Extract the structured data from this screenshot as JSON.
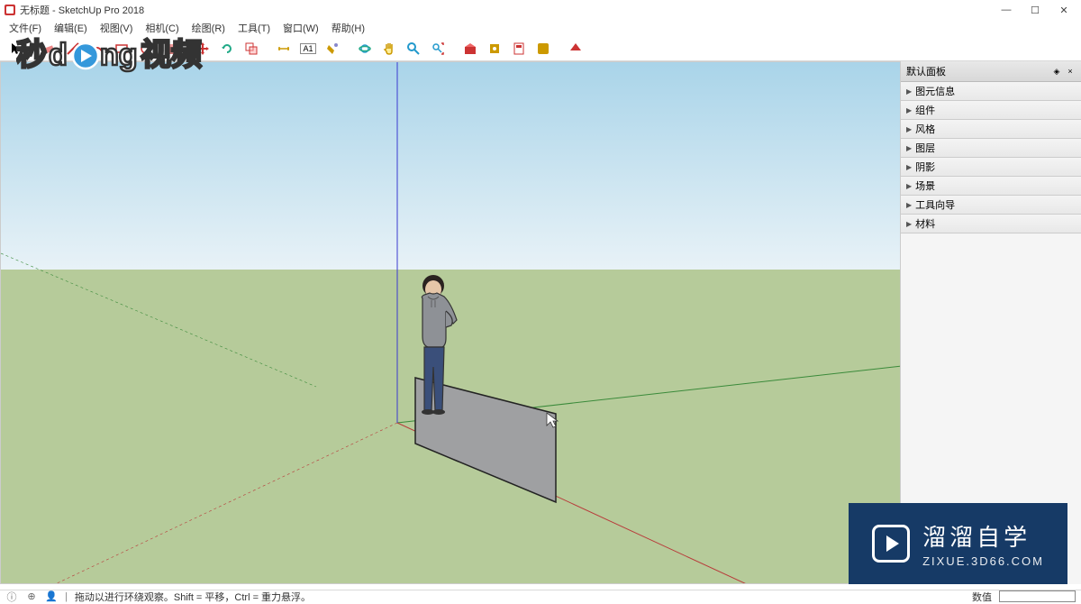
{
  "window": {
    "title": "无标题 - SketchUp Pro 2018",
    "minimize_glyph": "—",
    "maximize_glyph": "☐",
    "close_glyph": "✕"
  },
  "menu": {
    "file": "文件(F)",
    "edit": "编辑(E)",
    "view": "视图(V)",
    "camera": "相机(C)",
    "draw": "绘图(R)",
    "tools": "工具(T)",
    "window": "窗口(W)",
    "help": "帮助(H)"
  },
  "toolbar": {
    "select": "▶",
    "eraser": "◧",
    "line": "◢",
    "arc": "◡",
    "rect": "▭",
    "circle": "◯",
    "pushpull": "⬒",
    "move": "✥",
    "rotate": "⟳",
    "scale": "▣",
    "measure": "📏",
    "text": "A1",
    "paint": "🪣",
    "orbit": "🌐",
    "pan": "✋",
    "zoom": "🔍",
    "zoom_extents": "🔎",
    "warehouse": "📦",
    "share": "📤",
    "layout": "📄",
    "advanced": "⚙"
  },
  "panel": {
    "title": "默认面板",
    "pin_glyph": "◈",
    "close_glyph": "×",
    "items": [
      {
        "label": "图元信息"
      },
      {
        "label": "组件"
      },
      {
        "label": "风格"
      },
      {
        "label": "图层"
      },
      {
        "label": "阴影"
      },
      {
        "label": "场景"
      },
      {
        "label": "工具向导"
      },
      {
        "label": "材料"
      }
    ]
  },
  "status": {
    "hint": "拖动以进行环绕观察。Shift = 平移，Ctrl = 重力悬浮。",
    "value_label": "数值"
  },
  "watermark": {
    "logo_text": "秒d◯ng视频",
    "brand_cn": "溜溜自学",
    "brand_en": "ZIXUE.3D66.COM"
  },
  "colors": {
    "sky_top": "#cce6f4",
    "sky_bottom": "#f0f8fc",
    "ground": "#b2c995",
    "axis_blue": "#2a2aff",
    "axis_red": "#cc2a2a",
    "axis_green": "#2aa52a"
  }
}
